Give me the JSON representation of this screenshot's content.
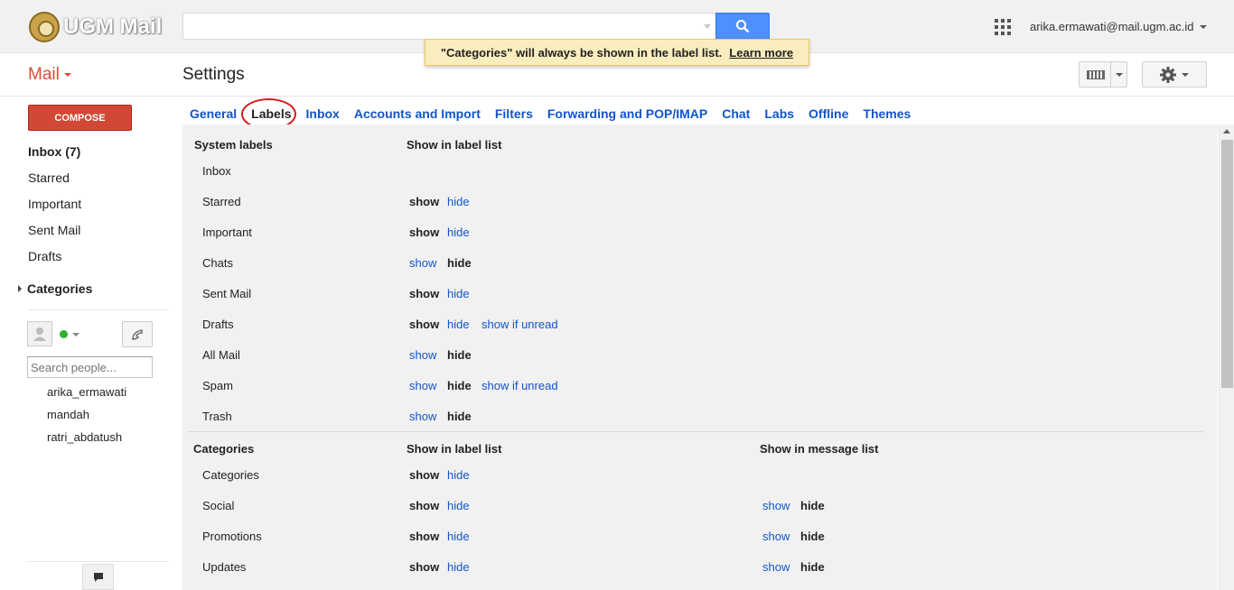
{
  "brand": {
    "logo_text": "UGM Mail"
  },
  "header": {
    "search": {
      "value": "",
      "placeholder": ""
    },
    "account_email": "arika.ermawati@mail.ugm.ac.id"
  },
  "notice": {
    "text": "\"Categories\" will always be shown in the label list.",
    "link": "Learn more"
  },
  "subbar": {
    "mail_label": "Mail",
    "title": "Settings"
  },
  "sidebar": {
    "compose": "COMPOSE",
    "items": [
      {
        "label": "Inbox (7)",
        "bold": true
      },
      {
        "label": "Starred"
      },
      {
        "label": "Important"
      },
      {
        "label": "Sent Mail"
      },
      {
        "label": "Drafts"
      }
    ],
    "categories": "Categories",
    "people_search_placeholder": "Search people...",
    "contacts": [
      "arika_ermawati",
      "mandah",
      "ratri_abdatush"
    ]
  },
  "tabs": [
    "General",
    "Labels",
    "Inbox",
    "Accounts and Import",
    "Filters",
    "Forwarding and POP/IMAP",
    "Chat",
    "Labs",
    "Offline",
    "Themes"
  ],
  "active_tab": "Labels",
  "system_labels": {
    "header": "System labels",
    "col_header": "Show in label list",
    "rows": [
      {
        "name": "Inbox",
        "options": []
      },
      {
        "name": "Starred",
        "options": [
          {
            "t": "show",
            "sel": true
          },
          {
            "t": "hide"
          }
        ]
      },
      {
        "name": "Important",
        "options": [
          {
            "t": "show",
            "sel": true
          },
          {
            "t": "hide"
          }
        ]
      },
      {
        "name": "Chats",
        "options": [
          {
            "t": "show"
          },
          {
            "t": "hide",
            "sel": true
          }
        ]
      },
      {
        "name": "Sent Mail",
        "options": [
          {
            "t": "show",
            "sel": true
          },
          {
            "t": "hide"
          }
        ]
      },
      {
        "name": "Drafts",
        "options": [
          {
            "t": "show",
            "sel": true
          },
          {
            "t": "hide"
          },
          {
            "t": "show if unread"
          }
        ]
      },
      {
        "name": "All Mail",
        "options": [
          {
            "t": "show"
          },
          {
            "t": "hide",
            "sel": true
          }
        ]
      },
      {
        "name": "Spam",
        "options": [
          {
            "t": "show"
          },
          {
            "t": "hide",
            "sel": true
          },
          {
            "t": "show if unread"
          }
        ]
      },
      {
        "name": "Trash",
        "options": [
          {
            "t": "show"
          },
          {
            "t": "hide",
            "sel": true
          }
        ]
      }
    ]
  },
  "categories": {
    "header": "Categories",
    "col_header": "Show in label list",
    "col_header2": "Show in message list",
    "rows": [
      {
        "name": "Categories",
        "options": [
          {
            "t": "show",
            "sel": true
          },
          {
            "t": "hide"
          }
        ],
        "msg_options": []
      },
      {
        "name": "Social",
        "options": [
          {
            "t": "show",
            "sel": true
          },
          {
            "t": "hide"
          }
        ],
        "msg_options": [
          {
            "t": "show"
          },
          {
            "t": "hide",
            "sel": true
          }
        ]
      },
      {
        "name": "Promotions",
        "options": [
          {
            "t": "show",
            "sel": true
          },
          {
            "t": "hide"
          }
        ],
        "msg_options": [
          {
            "t": "show"
          },
          {
            "t": "hide",
            "sel": true
          }
        ]
      },
      {
        "name": "Updates",
        "options": [
          {
            "t": "show",
            "sel": true
          },
          {
            "t": "hide"
          }
        ],
        "msg_options": [
          {
            "t": "show"
          },
          {
            "t": "hide",
            "sel": true
          }
        ]
      }
    ]
  }
}
